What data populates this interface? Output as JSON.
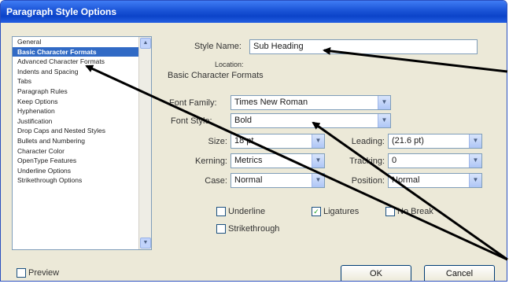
{
  "window": {
    "title": "Paragraph Style Options"
  },
  "sidebar": {
    "items": [
      {
        "label": "General"
      },
      {
        "label": "Basic Character Formats",
        "selected": true
      },
      {
        "label": "Advanced Character Formats"
      },
      {
        "label": "Indents and Spacing"
      },
      {
        "label": "Tabs"
      },
      {
        "label": "Paragraph Rules"
      },
      {
        "label": "Keep Options"
      },
      {
        "label": "Hyphenation"
      },
      {
        "label": "Justification"
      },
      {
        "label": "Drop Caps and Nested Styles"
      },
      {
        "label": "Bullets and Numbering"
      },
      {
        "label": "Character Color"
      },
      {
        "label": "OpenType Features"
      },
      {
        "label": "Underline Options"
      },
      {
        "label": "Strikethrough Options"
      }
    ]
  },
  "form": {
    "style_name_label": "Style Name:",
    "style_name_value": "Sub Heading",
    "location_label": "Location:",
    "section_title": "Basic Character Formats",
    "font_family_label": "Font Family:",
    "font_family_value": "Times New Roman",
    "font_style_label": "Font Style:",
    "font_style_value": "Bold",
    "size_label": "Size:",
    "size_value": "18 pt",
    "leading_label": "Leading:",
    "leading_value": "(21.6 pt)",
    "kerning_label": "Kerning:",
    "kerning_value": "Metrics",
    "tracking_label": "Tracking:",
    "tracking_value": "0",
    "case_label": "Case:",
    "case_value": "Normal",
    "position_label": "Position:",
    "position_value": "Normal"
  },
  "checkboxes": {
    "underline": {
      "label": "Underline",
      "checked": false
    },
    "ligatures": {
      "label": "Ligatures",
      "checked": true
    },
    "no_break": {
      "label": "No Break",
      "checked": false
    },
    "strikethrough": {
      "label": "Strikethrough",
      "checked": false
    }
  },
  "footer": {
    "preview_label": "Preview",
    "preview_checked": false,
    "ok_label": "OK",
    "cancel_label": "Cancel"
  },
  "colors": {
    "titlebar": "#0c44c9",
    "selection": "#316ac5",
    "dialog_bg": "#ece9d8",
    "annotation_arrow": "#000000"
  }
}
